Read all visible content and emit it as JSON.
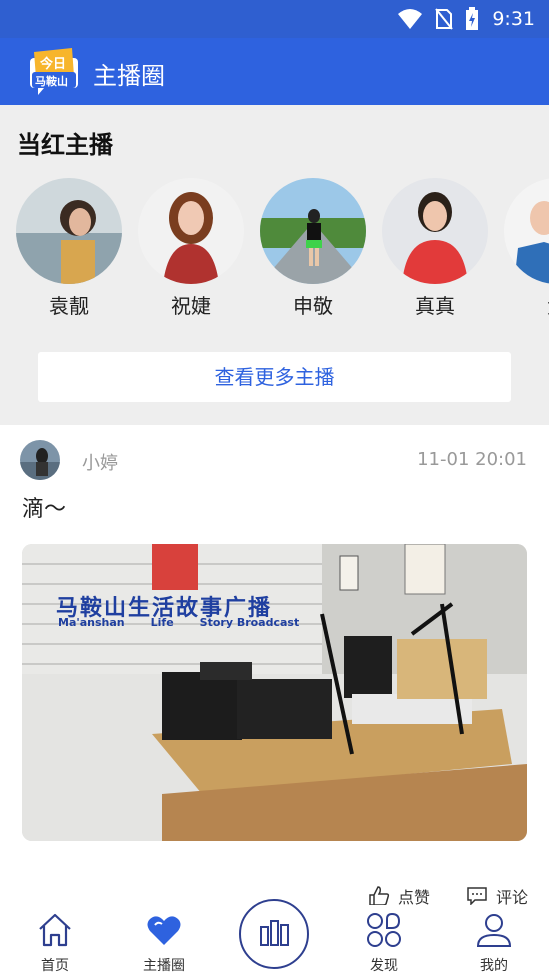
{
  "status_bar": {
    "time": "9:31"
  },
  "app_bar": {
    "title": "主播圈",
    "logo_text_top": "今日",
    "logo_text_bottom": "马鞍山"
  },
  "featured": {
    "heading": "当红主播",
    "hosts": [
      {
        "name": "袁靓"
      },
      {
        "name": "祝婕"
      },
      {
        "name": "申敬"
      },
      {
        "name": "真真"
      },
      {
        "name": "大"
      }
    ],
    "more_button": "查看更多主播"
  },
  "post": {
    "username": "小婷",
    "time": "11-01 20:01",
    "text": "滴～",
    "image": {
      "sign_line1": "马鞍山生活故事广播",
      "sign_en1": "Ma'anshan",
      "sign_en2": "Life",
      "sign_en3": "Story Broadcast"
    },
    "like_label": "点赞",
    "comment_label": "评论"
  },
  "tabs": [
    {
      "label": "首页",
      "icon": "home-icon"
    },
    {
      "label": "主播圈",
      "icon": "heart-icon"
    },
    {
      "label": "",
      "icon": "equalizer-icon"
    },
    {
      "label": "发现",
      "icon": "discover-icon"
    },
    {
      "label": "我的",
      "icon": "user-icon"
    }
  ],
  "colors": {
    "primary": "#2e62df",
    "background_grey": "#eeeeee",
    "text_muted": "#999999"
  }
}
